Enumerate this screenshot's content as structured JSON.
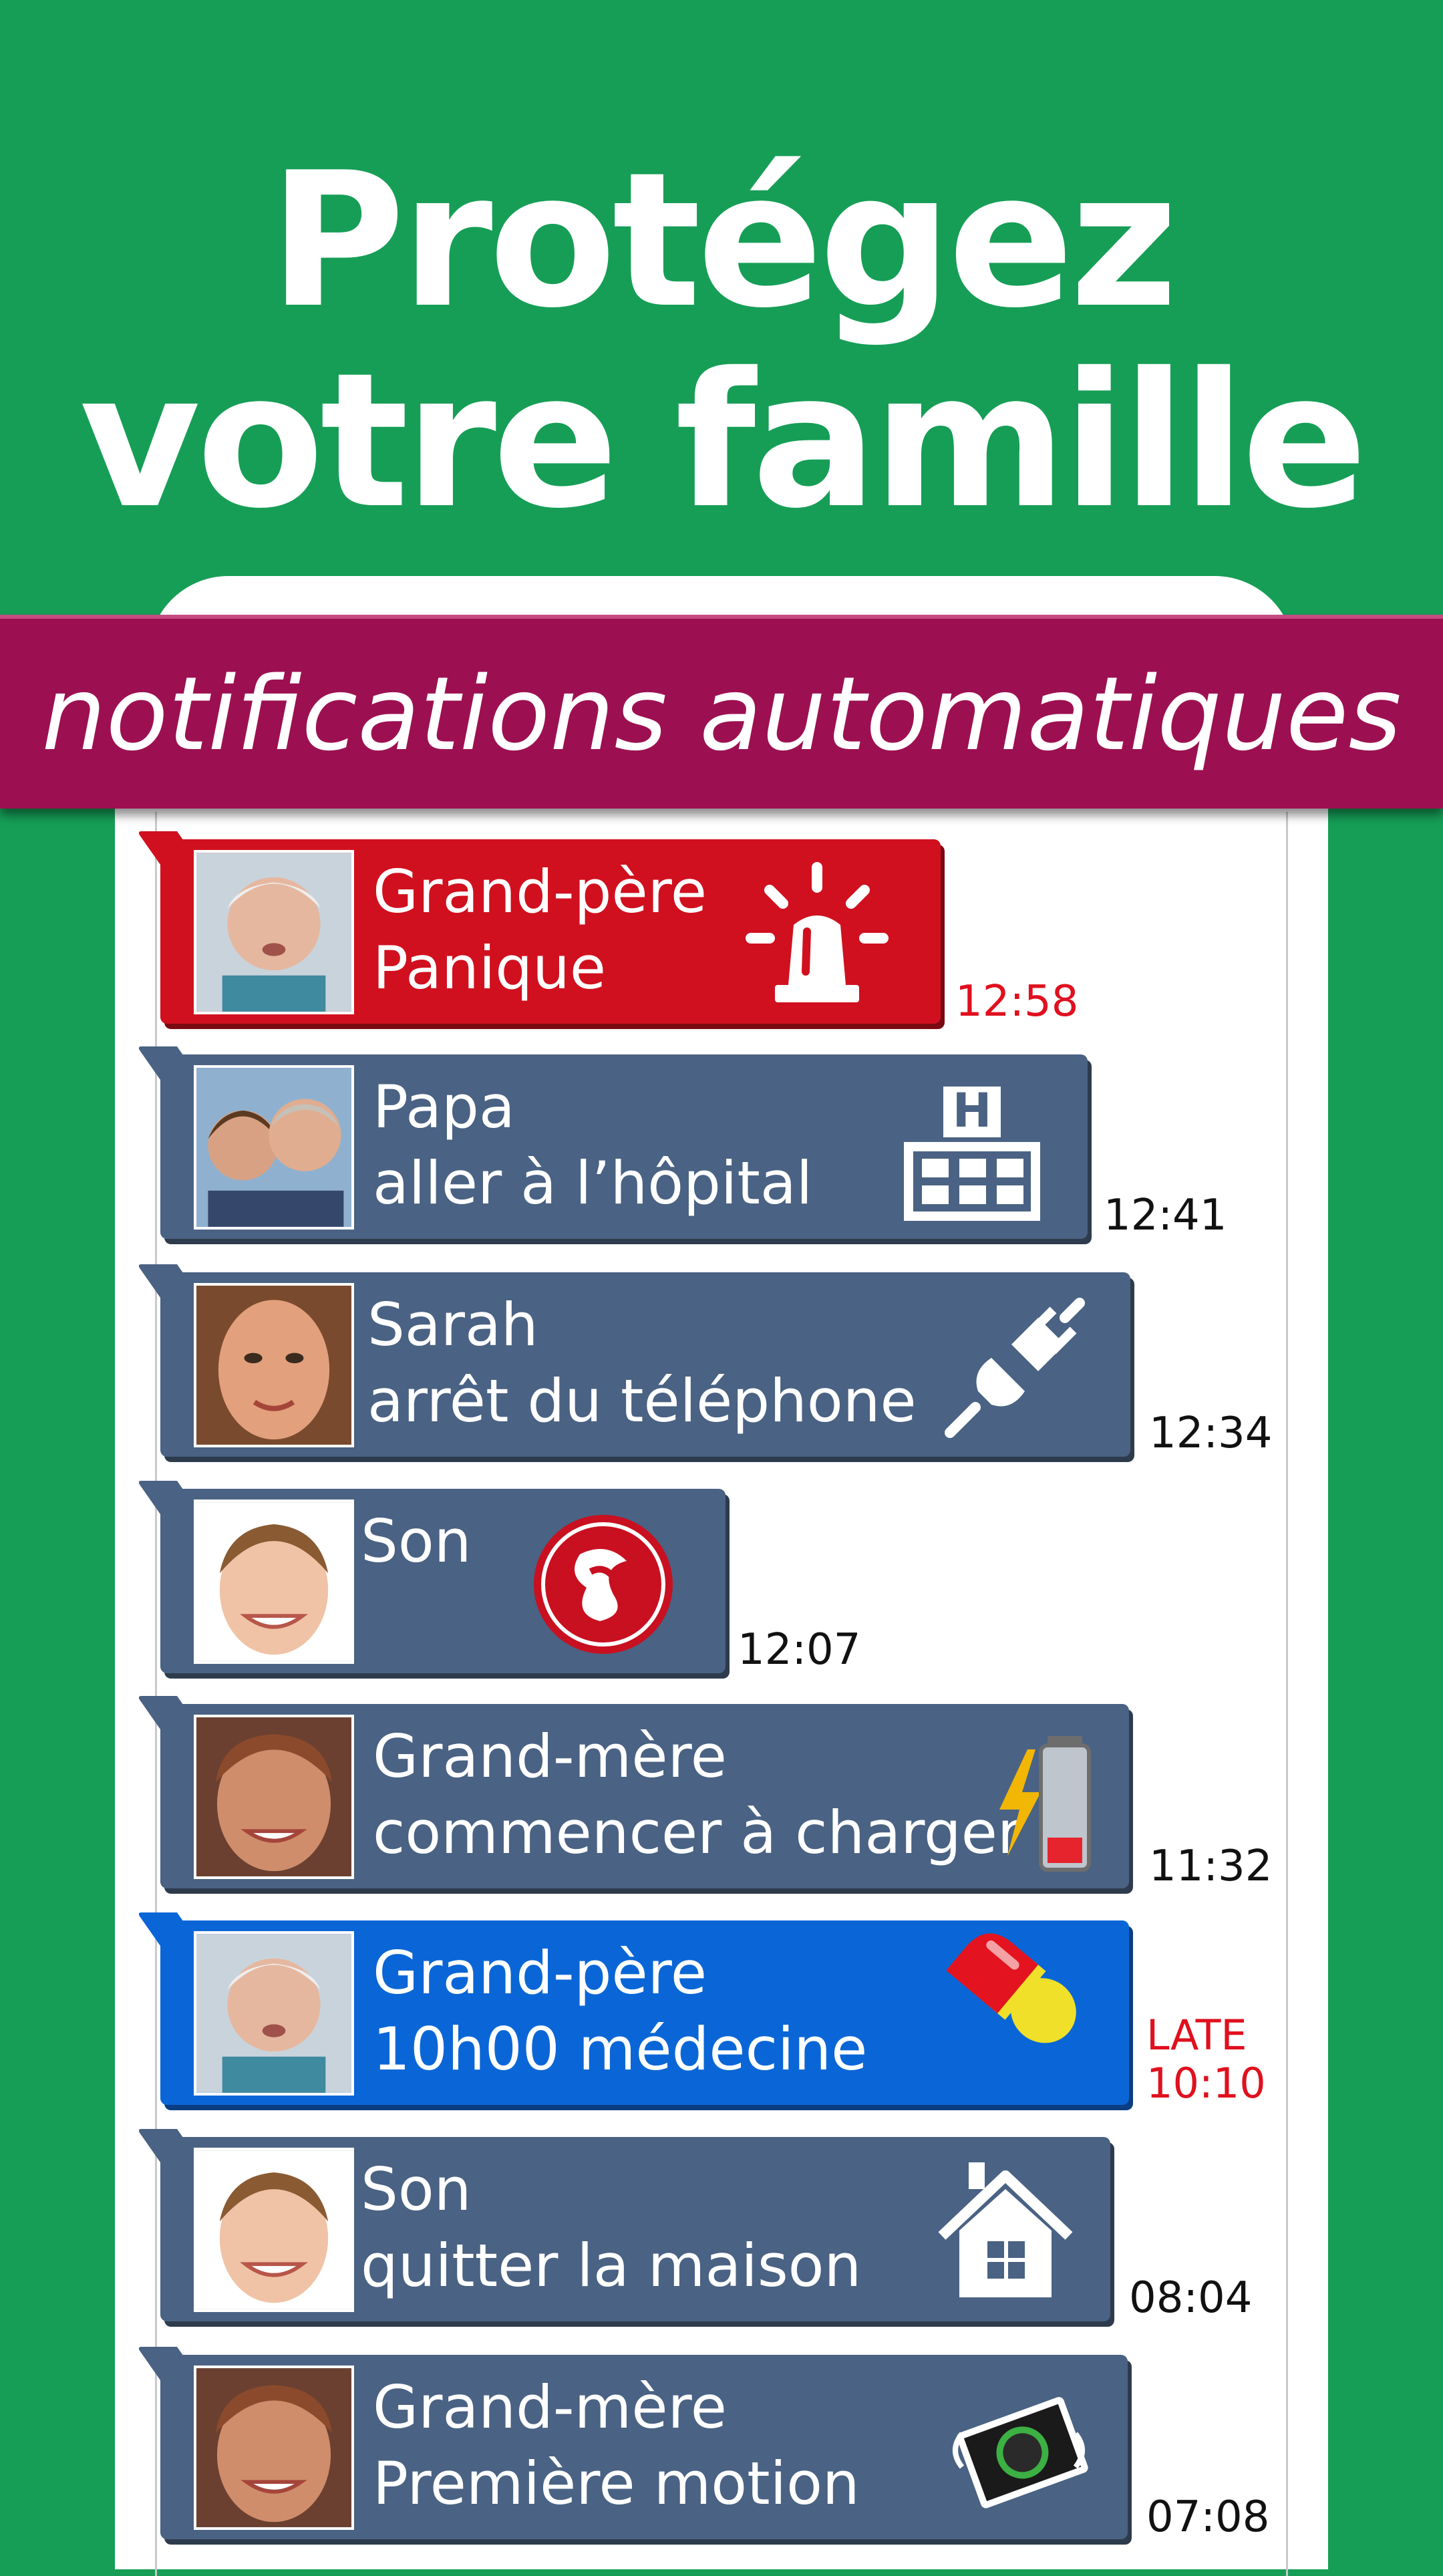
{
  "headline": {
    "line1": "Protégez",
    "line2": "votre famille"
  },
  "ribbon": {
    "text": "notifications automatiques"
  },
  "colors": {
    "background": "#169e56",
    "ribbon": "#9c1051",
    "card": "#4a6283",
    "alert": "#d0101e",
    "highlight": "#0a66d6",
    "late": "#e0101e"
  },
  "notifications": [
    {
      "name": "Grand-père",
      "message": "Panique",
      "time": "12:58",
      "icon": "siren-icon",
      "style": "red"
    },
    {
      "name": "Papa",
      "message": "aller à l’hôpital",
      "time": "12:41",
      "icon": "hospital-icon",
      "style": "slate"
    },
    {
      "name": "Sarah",
      "message": "arrêt du téléphone",
      "time": "12:34",
      "icon": "unplug-icon",
      "style": "slate"
    },
    {
      "name": "Son",
      "message": "",
      "time": "12:07",
      "icon": "app-logo-icon",
      "style": "slate"
    },
    {
      "name": "Grand-mère",
      "message": "commencer à charger",
      "time": "11:32",
      "icon": "battery-charging-icon",
      "style": "slate"
    },
    {
      "name": "Grand-père",
      "message": "10h00 médecine",
      "time": "10:10",
      "late_label": "LATE",
      "icon": "pill-icon",
      "style": "blue"
    },
    {
      "name": "Son",
      "message": "quitter la maison",
      "time": "08:04",
      "icon": "house-icon",
      "style": "slate"
    },
    {
      "name": "Grand-mère",
      "message": "Première motion",
      "time": "07:08",
      "icon": "camera-motion-icon",
      "style": "slate"
    }
  ]
}
